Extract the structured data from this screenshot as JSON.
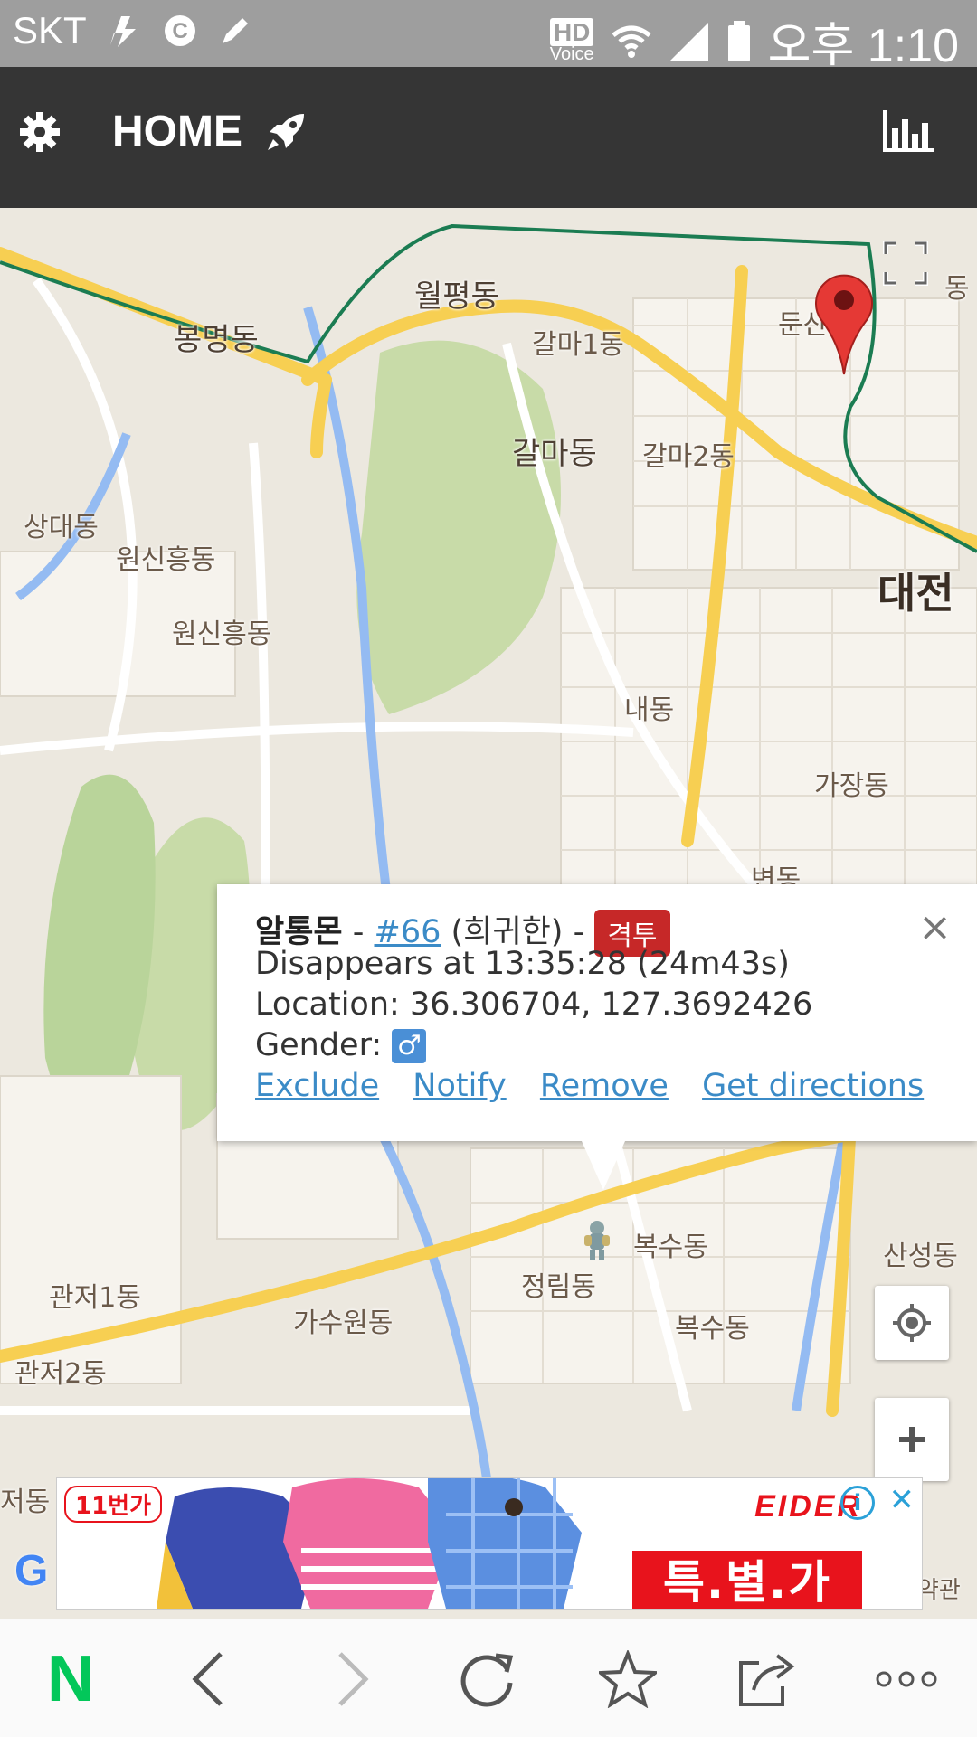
{
  "status_bar": {
    "carrier": "SKT",
    "hd_label": "HD",
    "voice_label": "Voice",
    "time": "오후 1:10"
  },
  "app_bar": {
    "title": "HOME",
    "icons": [
      "gear-icon",
      "rocket-icon",
      "bar-chart-icon"
    ]
  },
  "map": {
    "labels": [
      {
        "text": "월평동"
      },
      {
        "text": "봉명동"
      },
      {
        "text": "갈마1동"
      },
      {
        "text": "둔산"
      },
      {
        "text": "동"
      },
      {
        "text": "갈마동"
      },
      {
        "text": "갈마2동"
      },
      {
        "text": "상대동"
      },
      {
        "text": "원신흥동"
      },
      {
        "text": "원신흥동"
      },
      {
        "text": "대전"
      },
      {
        "text": "내동"
      },
      {
        "text": "가장동"
      },
      {
        "text": "변동"
      },
      {
        "text": "복수동"
      },
      {
        "text": "정림동"
      },
      {
        "text": "산성동"
      },
      {
        "text": "관저1동"
      },
      {
        "text": "가수원동"
      },
      {
        "text": "복수동"
      },
      {
        "text": "관저2동"
      },
      {
        "text": "저동"
      },
      {
        "text": "약관"
      }
    ],
    "controls": [
      "fullscreen-icon",
      "my-location-icon",
      "zoom-in-icon"
    ]
  },
  "popup": {
    "name": "알통몬",
    "sep1": " - ",
    "number": "#66",
    "rarity": "(희귀한)",
    "sep2": " - ",
    "type_badge": "격투",
    "disappears": "Disappears at 13:35:28 (24m43s)",
    "location": "Location: 36.306704, 127.3692426",
    "gender_label": "Gender:",
    "gender_symbol": "♂",
    "links": {
      "exclude": "Exclude",
      "notify": "Notify",
      "remove": "Remove",
      "directions": "Get directions"
    },
    "close": "×"
  },
  "ad": {
    "tag": "11번가",
    "brand": "EIDER",
    "special": "특.별.가",
    "info": "i",
    "close": "✕"
  },
  "bottom_nav": {
    "logo": "N",
    "icons": [
      "back-icon",
      "forward-icon",
      "refresh-icon",
      "star-icon",
      "share-icon",
      "more-icon"
    ]
  },
  "colors": {
    "appbar": "#353535",
    "statusbar": "#9e9e9e",
    "link": "#3b8bc7",
    "badge": "#c62828",
    "naver_green": "#03c75a"
  }
}
